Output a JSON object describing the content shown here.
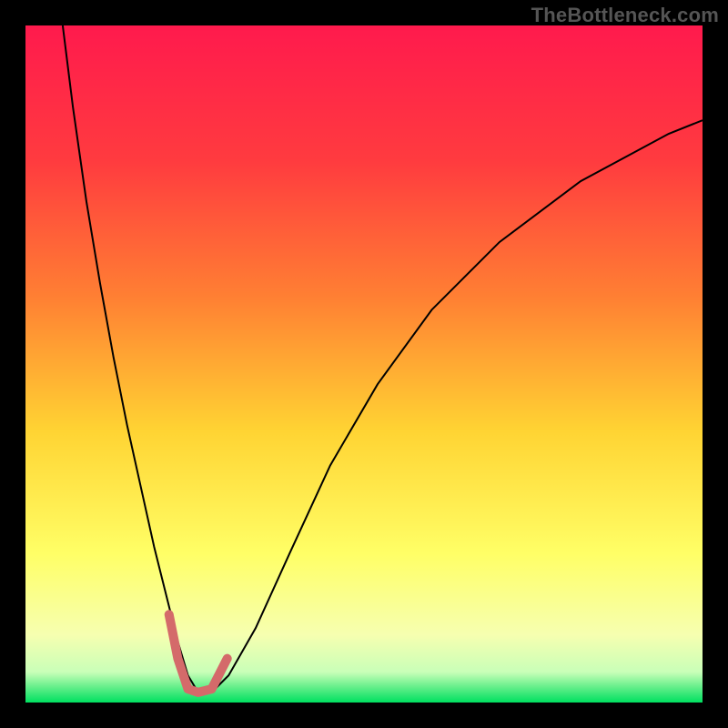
{
  "watermark": {
    "text": "TheBottleneck.com"
  },
  "chart_data": {
    "type": "line",
    "title": "",
    "xlabel": "",
    "ylabel": "",
    "xlim": [
      0,
      100
    ],
    "ylim": [
      0,
      100
    ],
    "grid": false,
    "legend": false,
    "background": {
      "type": "vertical-gradient",
      "stops": [
        {
          "pos": 0.0,
          "color": "#ff1a4d"
        },
        {
          "pos": 0.2,
          "color": "#ff3b3f"
        },
        {
          "pos": 0.4,
          "color": "#ff7f33"
        },
        {
          "pos": 0.6,
          "color": "#ffd433"
        },
        {
          "pos": 0.78,
          "color": "#ffff66"
        },
        {
          "pos": 0.9,
          "color": "#f6ffb0"
        },
        {
          "pos": 0.955,
          "color": "#c9ffb8"
        },
        {
          "pos": 0.975,
          "color": "#6ef08e"
        },
        {
          "pos": 1.0,
          "color": "#00e060"
        }
      ]
    },
    "series": [
      {
        "name": "bottleneck-curve",
        "stroke": "#000000",
        "stroke_width": 2,
        "x": [
          5.5,
          7,
          9,
          11,
          13,
          15,
          17,
          19,
          21,
          22.5,
          24,
          25.5,
          27.5,
          30,
          34,
          39,
          45,
          52,
          60,
          70,
          82,
          95,
          100
        ],
        "y": [
          100,
          88,
          74,
          62,
          51,
          41,
          32,
          23,
          15,
          9,
          4,
          1.5,
          1.5,
          4,
          11,
          22,
          35,
          47,
          58,
          68,
          77,
          84,
          86
        ]
      },
      {
        "name": "optimal-region-highlight",
        "stroke": "#d46a6a",
        "stroke_width": 10,
        "linecap": "round",
        "x": [
          21.2,
          22.5,
          24,
          25.5,
          27.5,
          29.8
        ],
        "y": [
          13,
          6.5,
          2,
          1.5,
          2,
          6.5
        ]
      }
    ],
    "annotations": []
  }
}
